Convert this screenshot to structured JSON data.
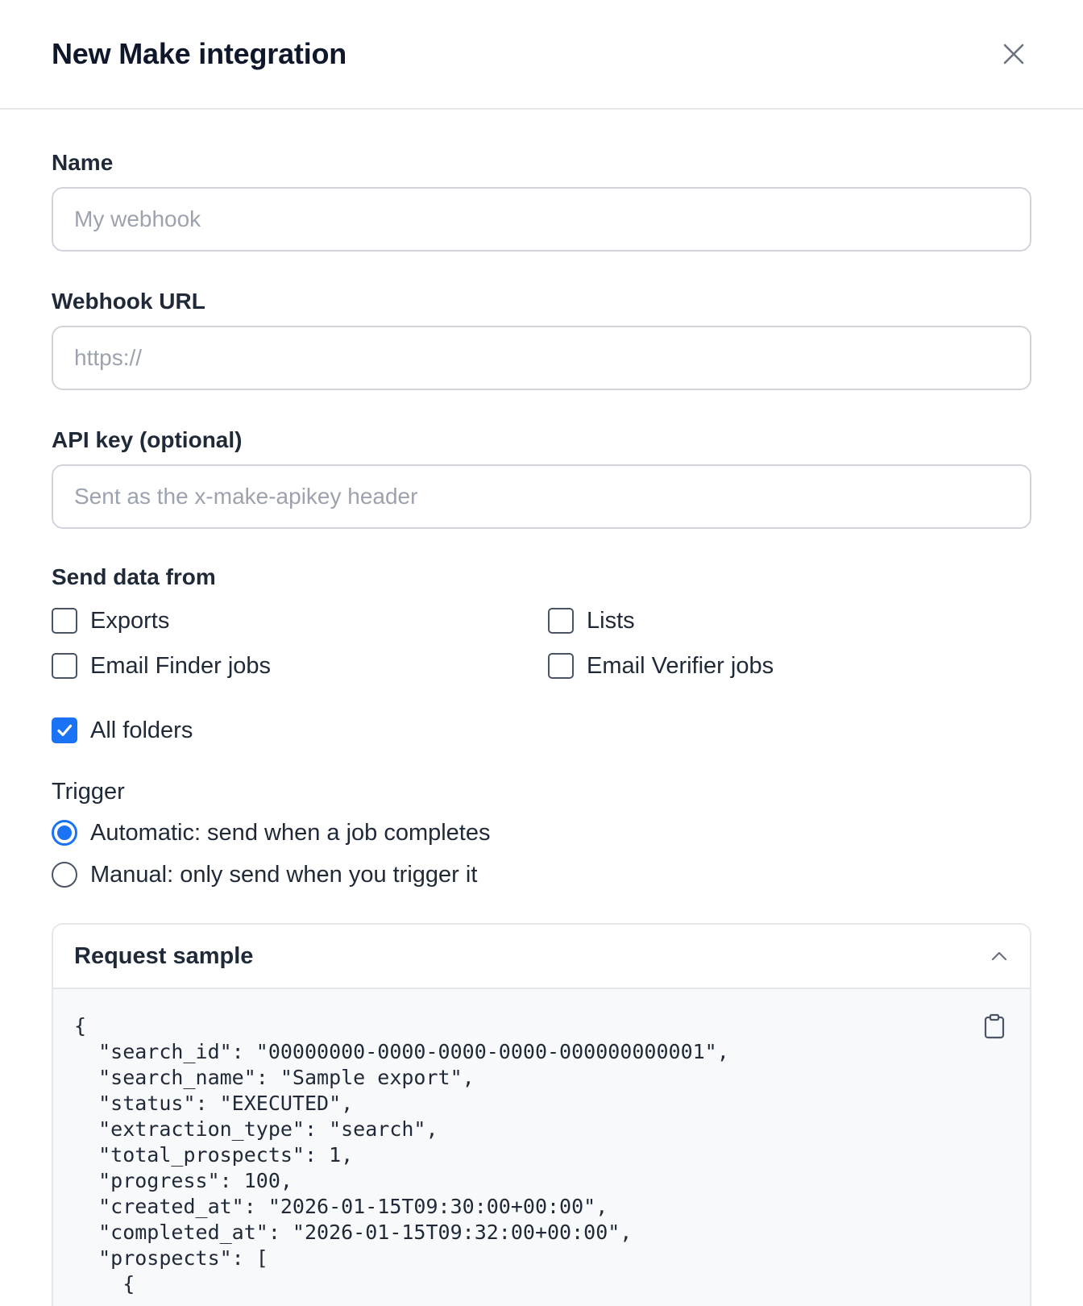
{
  "modal": {
    "title": "New Make integration",
    "close_icon": "close-icon"
  },
  "form": {
    "name": {
      "label": "Name",
      "placeholder": "My webhook",
      "value": ""
    },
    "webhook_url": {
      "label": "Webhook URL",
      "placeholder": "https://",
      "value": ""
    },
    "api_key": {
      "label": "API key (optional)",
      "placeholder": "Sent as the x-make-apikey header",
      "value": ""
    }
  },
  "send_data_from": {
    "label": "Send data from",
    "options": [
      {
        "label": "Exports",
        "checked": false
      },
      {
        "label": "Lists",
        "checked": false
      },
      {
        "label": "Email Finder jobs",
        "checked": false
      },
      {
        "label": "Email Verifier jobs",
        "checked": false
      }
    ]
  },
  "all_folders": {
    "label": "All folders",
    "checked": true
  },
  "trigger": {
    "label": "Trigger",
    "options": [
      {
        "label": "Automatic: send when a job completes",
        "selected": true
      },
      {
        "label": "Manual: only send when you trigger it",
        "selected": false
      }
    ]
  },
  "request_sample": {
    "title": "Request sample",
    "toggle_icon": "chevron-up-icon",
    "copy_icon": "clipboard-icon",
    "code": "{\n  \"search_id\": \"00000000-0000-0000-0000-000000000001\",\n  \"search_name\": \"Sample export\",\n  \"status\": \"EXECUTED\",\n  \"extraction_type\": \"search\",\n  \"total_prospects\": 1,\n  \"progress\": 100,\n  \"created_at\": \"2026-01-15T09:30:00+00:00\",\n  \"completed_at\": \"2026-01-15T09:32:00+00:00\",\n  \"prospects\": [\n    {"
  },
  "colors": {
    "accent": "#1a73f5",
    "border": "#d1d5db",
    "placeholder": "#9ca3af",
    "code_background": "#f8f9fb"
  }
}
